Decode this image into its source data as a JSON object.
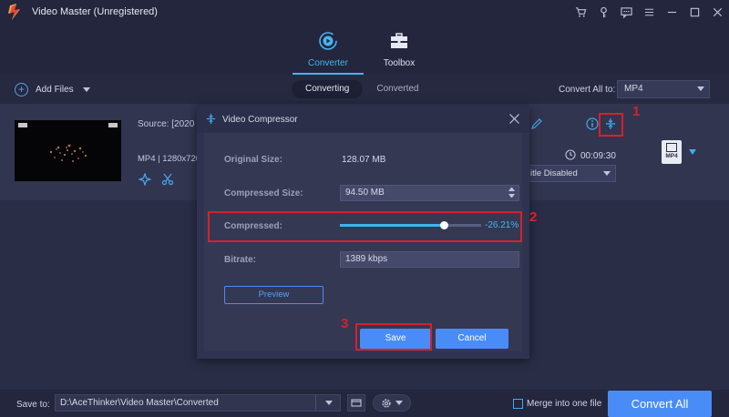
{
  "app": {
    "title": "Video Master (Unregistered)",
    "window_icons": [
      "cart-icon",
      "key-icon",
      "chat-icon",
      "menu-icon",
      "minimize-icon",
      "maximize-icon",
      "close-icon"
    ]
  },
  "main_tabs": [
    {
      "label": "Converter",
      "icon": "converter-icon",
      "active": true
    },
    {
      "label": "Toolbox",
      "icon": "toolbox-icon",
      "active": false
    }
  ],
  "toolbar": {
    "add_files": "Add Files",
    "sub_tabs": [
      {
        "label": "Converting",
        "active": true
      },
      {
        "label": "Converted",
        "active": false
      }
    ],
    "convert_all_to_label": "Convert All to:",
    "convert_all_to_value": "MP4"
  },
  "file_item": {
    "source": "Source: [2020",
    "meta": "MP4 | 1280x720",
    "duration": "00:09:30",
    "subtitle": "itle Disabled",
    "output_format": "MP4"
  },
  "dialog": {
    "title": "Video Compressor",
    "original_size_label": "Original Size:",
    "original_size_value": "128.07 MB",
    "compressed_size_label": "Compressed Size:",
    "compressed_size_value": "94.50 MB",
    "compressed_label": "Compressed:",
    "compressed_percent": "-26.21%",
    "compressed_fraction": 0.7379,
    "bitrate_label": "Bitrate:",
    "bitrate_value": "1389 kbps",
    "preview": "Preview",
    "save": "Save",
    "cancel": "Cancel"
  },
  "annotations": {
    "n1": "1",
    "n2": "2",
    "n3": "3"
  },
  "bottom": {
    "save_to_label": "Save to:",
    "save_path": "D:\\AceThinker\\Video Master\\Converted",
    "merge_label": "Merge into one file",
    "convert_all": "Convert All"
  },
  "colors": {
    "accent": "#45b4f0",
    "button": "#4a8cf7",
    "annotation": "#d9202a",
    "background": "#2a2d46"
  }
}
